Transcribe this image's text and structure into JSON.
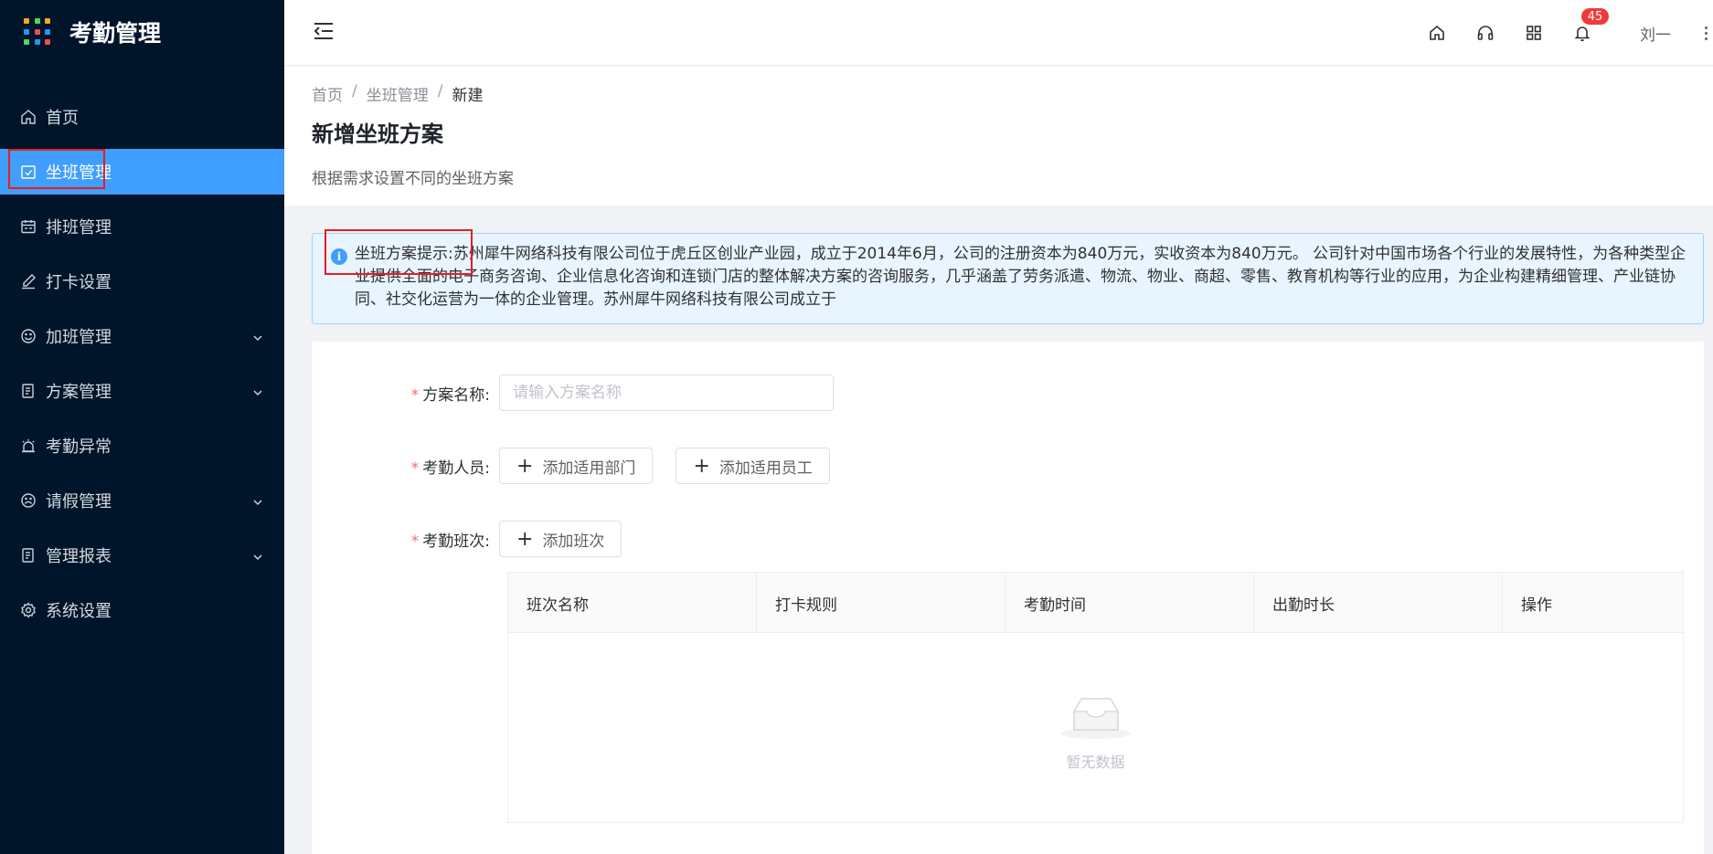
{
  "app": {
    "title": "考勤管理",
    "logo_colors": [
      "#f5a623",
      "#4cd964",
      "#f5a623",
      "#2196f3",
      "#e94e4e",
      "#2196f3",
      "#4cd964",
      "#2196f3",
      "#e94e4e"
    ]
  },
  "sidebar": {
    "items": [
      {
        "label": "首页",
        "icon": "home-icon",
        "active": false,
        "has_arrow": false
      },
      {
        "label": "坐班管理",
        "icon": "calendar-check-icon",
        "active": true,
        "has_arrow": false
      },
      {
        "label": "排班管理",
        "icon": "schedule-icon",
        "active": false,
        "has_arrow": false
      },
      {
        "label": "打卡设置",
        "icon": "edit-icon",
        "active": false,
        "has_arrow": false
      },
      {
        "label": "加班管理",
        "icon": "smile-icon",
        "active": false,
        "has_arrow": true
      },
      {
        "label": "方案管理",
        "icon": "document-icon",
        "active": false,
        "has_arrow": true
      },
      {
        "label": "考勤异常",
        "icon": "alarm-icon",
        "active": false,
        "has_arrow": false
      },
      {
        "label": "请假管理",
        "icon": "frown-icon",
        "active": false,
        "has_arrow": true
      },
      {
        "label": "管理报表",
        "icon": "report-icon",
        "active": false,
        "has_arrow": true
      },
      {
        "label": "系统设置",
        "icon": "gear-icon",
        "active": false,
        "has_arrow": false
      }
    ]
  },
  "header": {
    "notification_count": "45",
    "user_name": "刘一"
  },
  "breadcrumb": {
    "items": [
      "首页",
      "坐班管理",
      "新建"
    ],
    "separator": "/"
  },
  "page": {
    "title": "新增坐班方案",
    "subtitle": "根据需求设置不同的坐班方案"
  },
  "alert": {
    "label": "坐班方案提示:",
    "text": "苏州犀牛网络科技有限公司位于虎丘区创业产业园，成立于2014年6月，公司的注册资本为840万元，实收资本为840万元。 公司针对中国市场各个行业的发展特性，为各种类型企业提供全面的电子商务咨询、企业信息化咨询和连锁门店的整体解决方案的咨询服务，几乎涵盖了劳务派遣、物流、物业、商超、零售、教育机构等行业的应用，为企业构建精细管理、产业链协同、社交化运营为一体的企业管理。苏州犀牛网络科技有限公司成立于"
  },
  "form": {
    "name_label": "方案名称:",
    "name_placeholder": "请输入方案名称",
    "name_value": "",
    "staff_label": "考勤人员:",
    "add_department": "添加适用部门",
    "add_employee": "添加适用员工",
    "shift_label": "考勤班次:",
    "add_shift": "添加班次"
  },
  "table": {
    "columns": [
      "班次名称",
      "打卡规则",
      "考勤时间",
      "出勤时长",
      "操作"
    ],
    "rows": [],
    "empty_text": "暂无数据"
  },
  "colors": {
    "sidebar_bg": "#001529",
    "accent": "#409eff",
    "highlight": "#e81e1e",
    "badge": "#f03a3a"
  }
}
